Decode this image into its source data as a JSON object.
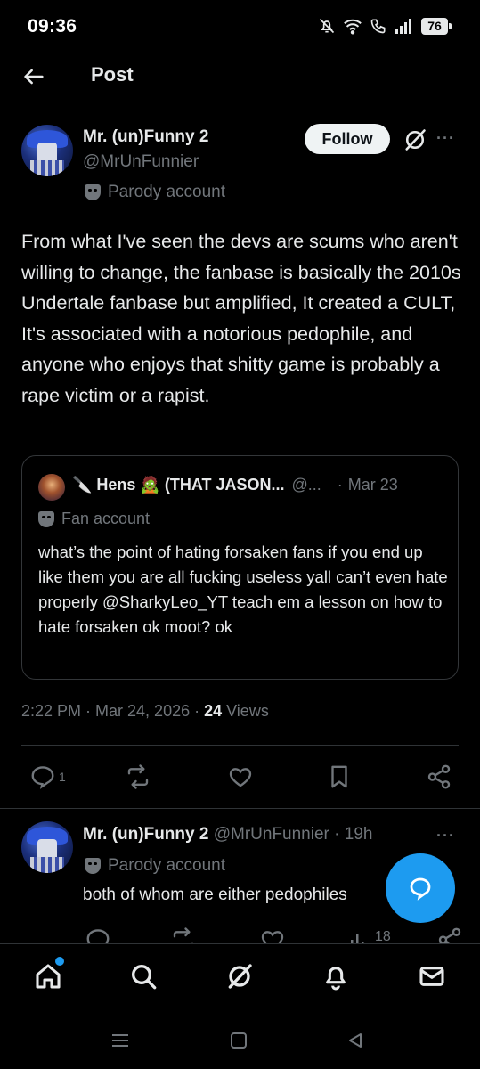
{
  "status_bar": {
    "time": "09:36",
    "battery": "76",
    "icons": [
      "mute-icon",
      "wifi-icon",
      "wifi-call-icon",
      "signal-icon",
      "battery-icon"
    ]
  },
  "header": {
    "title": "Post",
    "back_icon": "arrow-left-icon"
  },
  "post": {
    "author": {
      "name": "Mr. (un)Funny 2",
      "handle": "@MrUnFunnier",
      "label": "Parody account"
    },
    "follow_label": "Follow",
    "more_label": "···",
    "text": "From what I've seen the devs are scums who aren't willing to change, the fanbase is basically the 2010s Undertale fanbase but amplified, It created a CULT, It's associated with a notorious pedophile, and anyone who enjoys that shitty game is probably a rape victim or a rapist.",
    "quote": {
      "name": "🔪 Hens 🧟 (THAT JASON...",
      "handle": "@...",
      "sep": "·",
      "date": "Mar 23",
      "label": "Fan account",
      "text": "what’s the point of hating forsaken fans if you end up like them you are all fucking useless yall can’t even hate properly @SharkyLeo_YT teach em a lesson on how to hate forsaken ok moot? ok"
    },
    "meta": {
      "time_date": "2:22 PM · Mar 24, 2026 · ",
      "views_count": "24",
      "views_label": " Views"
    },
    "actions": {
      "reply_count": "1"
    }
  },
  "reply": {
    "name": "Mr. (un)Funny 2",
    "handle_time": " @MrUnFunnier · 19h",
    "label": "Parody account",
    "text": "both of whom are either pedophiles",
    "views_count": "18",
    "more_label": "···"
  },
  "colors": {
    "background": "#000000",
    "text": "#e7e9ea",
    "secondary": "#71767b",
    "accent": "#1d9bf0",
    "divider": "#2f3336"
  }
}
